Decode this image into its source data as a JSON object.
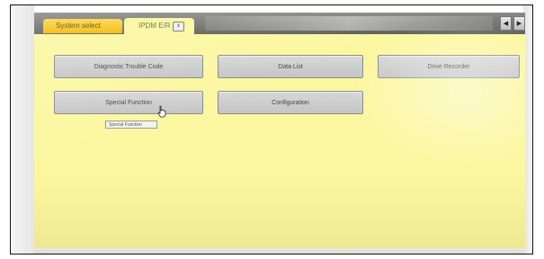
{
  "tabs": {
    "system_select": "System select",
    "ipdm": "IPDM E/R",
    "close_glyph": "x"
  },
  "nav": {
    "prev": "◀",
    "next": "▶"
  },
  "buttons": {
    "diagnostic_trouble_code": "Diagnostic Trouble Code",
    "data_list": "Data List",
    "drive_recorder": "Drive Recorder",
    "special_function": "Special Function",
    "configuration": "Configuration"
  },
  "tooltip": "Special Function",
  "colors": {
    "screen_bg": "#fbf7a0",
    "active_tab": "#f5b800",
    "button_bg": "#cfcfcf"
  }
}
